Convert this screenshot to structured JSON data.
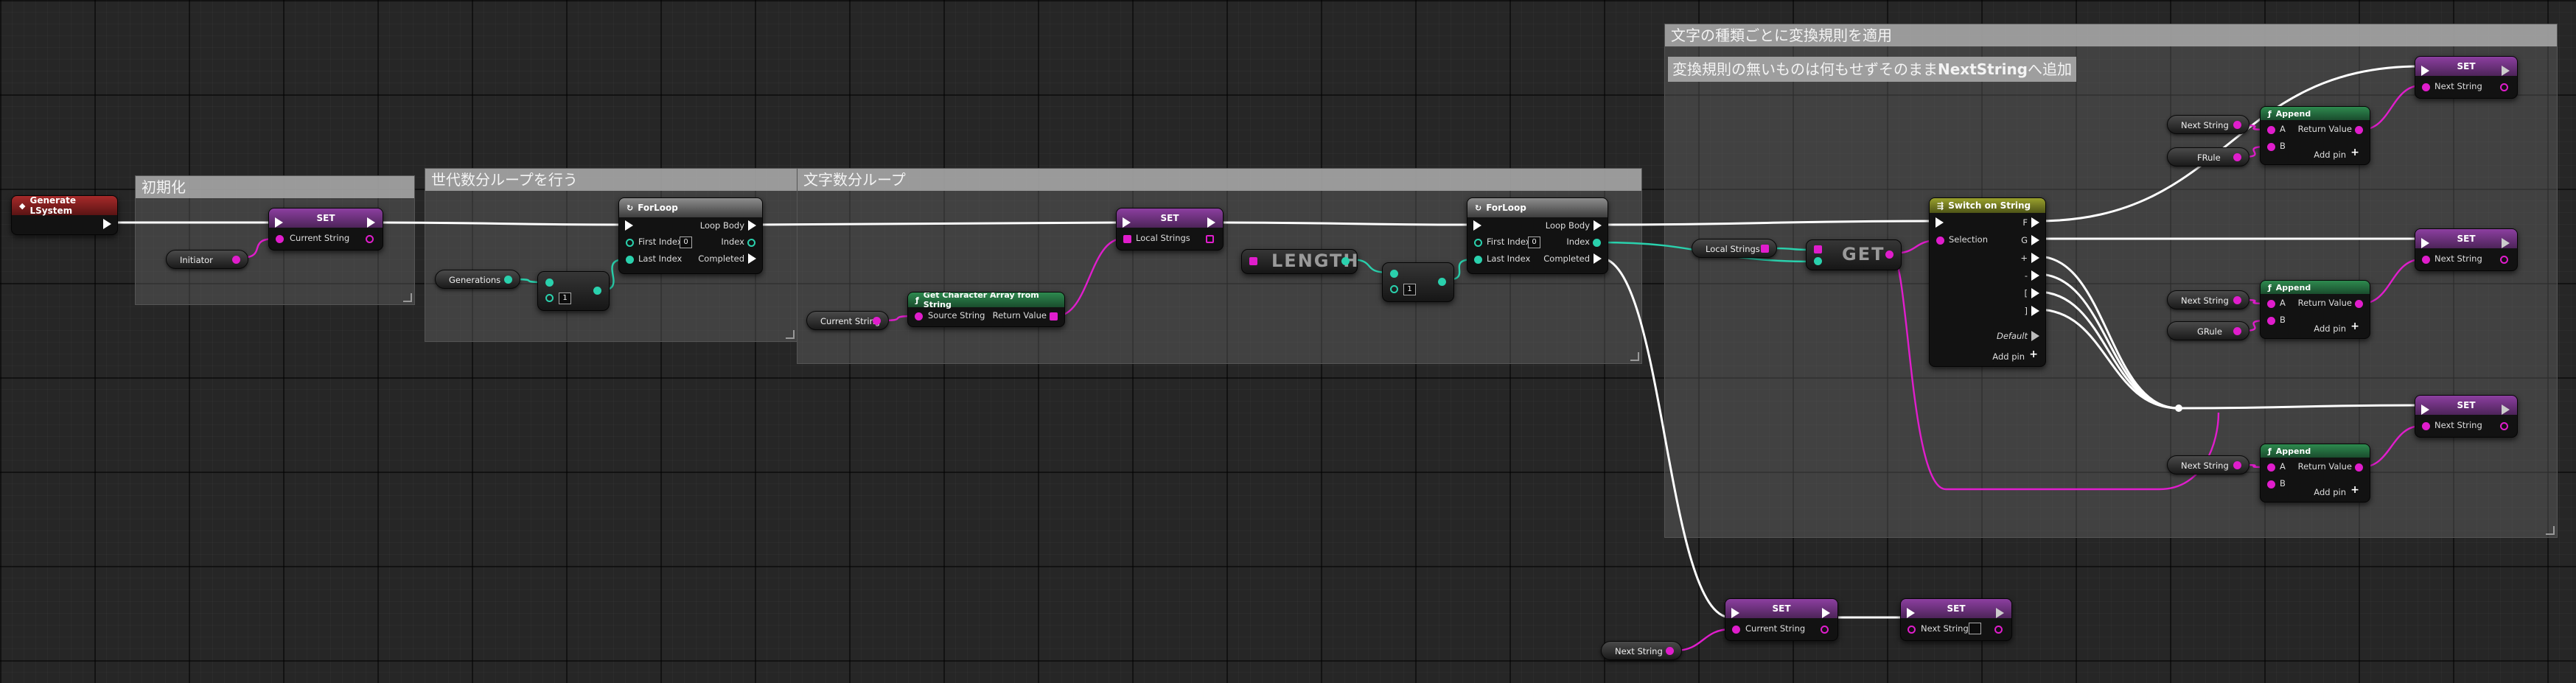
{
  "comments": {
    "init": "初期化",
    "gen_loop": "世代数分ループを行う",
    "char_loop": "文字数分ループ",
    "apply_rules": "文字の種類ごとに変換規則を適用",
    "no_rule_prefix": "変換規則の無いものは何もせずそのまま",
    "no_rule_bold": "NextString",
    "no_rule_suffix": "へ追加"
  },
  "nodes": {
    "event": {
      "title": "Generate LSystem"
    },
    "set_current": {
      "title": "SET",
      "pin": "Current String"
    },
    "initiator": "Initiator",
    "generations": "Generations",
    "forloop1": {
      "title": "ForLoop",
      "loop_body": "Loop Body",
      "first_index": "First Index",
      "first_value": "0",
      "index": "Index",
      "last_index": "Last Index",
      "completed": "Completed"
    },
    "minus1": {
      "value": "1"
    },
    "current_string_get": "Current String",
    "char_array": {
      "title": "Get Character Array from String",
      "source": "Source String",
      "return": "Return Value"
    },
    "set_local": {
      "title": "SET",
      "pin": "Local Strings"
    },
    "length": "LENGTH",
    "minus2": {
      "value": "1"
    },
    "forloop2": {
      "title": "ForLoop",
      "loop_body": "Loop Body",
      "first_index": "First Index",
      "first_value": "0",
      "index": "Index",
      "last_index": "Last Index",
      "completed": "Completed"
    },
    "local_strings_get": "Local Strings",
    "get": "GET",
    "switch": {
      "title": "Switch on String",
      "selection": "Selection",
      "cases": [
        "F",
        "G",
        "+",
        "-",
        "[",
        "]"
      ],
      "default": "Default",
      "add_pin": "Add pin"
    },
    "next_string_1": "Next String",
    "frule": "FRule",
    "append1": {
      "title": "Append",
      "a": "A",
      "b": "B",
      "return": "Return Value",
      "add_pin": "Add pin"
    },
    "set_next_1": {
      "title": "SET",
      "pin": "Next String"
    },
    "set_next_2": {
      "title": "SET",
      "pin": "Next String"
    },
    "next_string_2": "Next String",
    "grule": "GRule",
    "append2": {
      "title": "Append",
      "a": "A",
      "b": "B",
      "return": "Return Value",
      "add_pin": "Add pin"
    },
    "set_next_3": {
      "title": "SET",
      "pin": "Next String"
    },
    "next_string_3": "Next String",
    "append3": {
      "title": "Append",
      "a": "A",
      "b": "B",
      "return": "Return Value",
      "add_pin": "Add pin"
    },
    "set_current_2": {
      "title": "SET",
      "pin": "Current String"
    },
    "next_string_4": "Next String",
    "set_next_4": {
      "title": "SET",
      "pin": "Next String"
    }
  },
  "colors": {
    "exec": "#ffffff",
    "string": "#e01dcc",
    "integer": "#2ad1ad"
  },
  "icons": {
    "function": "function-icon",
    "loop": "loop-icon",
    "event": "event-icon",
    "switch": "switch-icon"
  }
}
